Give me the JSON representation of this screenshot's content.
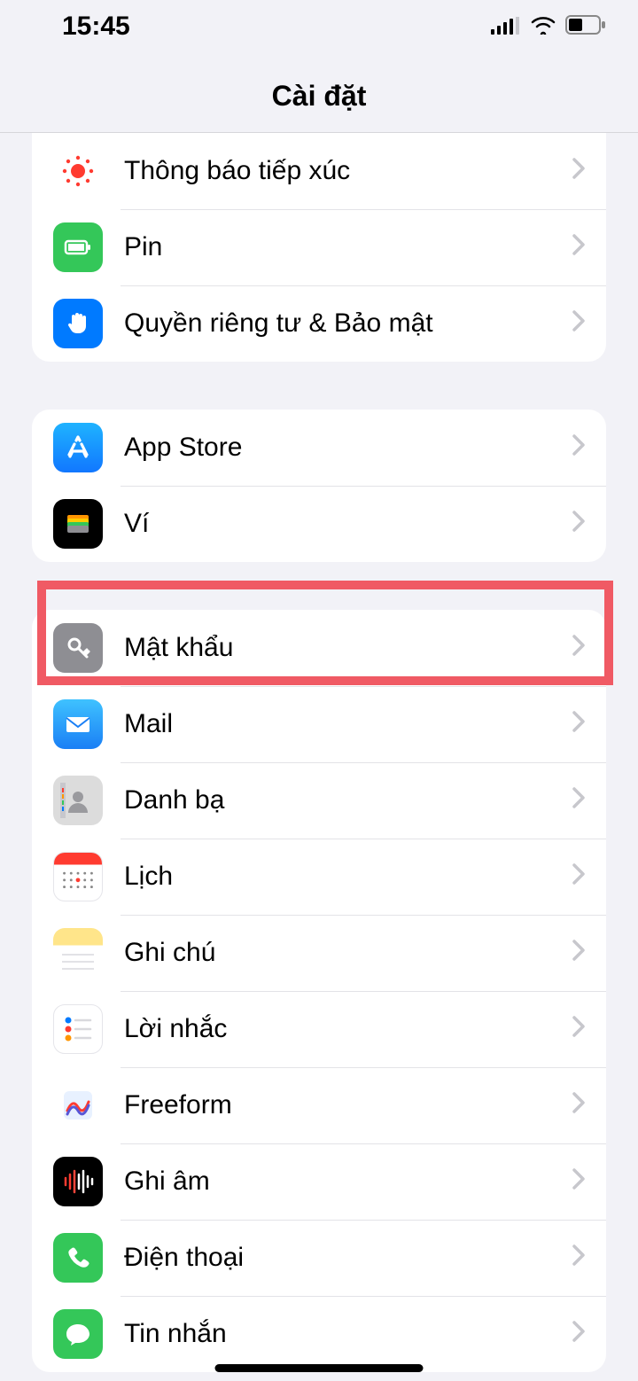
{
  "status": {
    "time": "15:45"
  },
  "header": {
    "title": "Cài đặt"
  },
  "groups": [
    {
      "rows": [
        {
          "id": "exposure",
          "label": "Thông báo tiếp xúc"
        },
        {
          "id": "battery",
          "label": "Pin"
        },
        {
          "id": "privacy",
          "label": "Quyền riêng tư & Bảo mật"
        }
      ]
    },
    {
      "rows": [
        {
          "id": "appstore",
          "label": "App Store"
        },
        {
          "id": "wallet",
          "label": "Ví"
        }
      ]
    },
    {
      "rows": [
        {
          "id": "passwords",
          "label": "Mật khẩu",
          "highlighted": true
        },
        {
          "id": "mail",
          "label": "Mail"
        },
        {
          "id": "contacts",
          "label": "Danh bạ"
        },
        {
          "id": "calendar",
          "label": "Lịch"
        },
        {
          "id": "notes",
          "label": "Ghi chú"
        },
        {
          "id": "reminders",
          "label": "Lời nhắc"
        },
        {
          "id": "freeform",
          "label": "Freeform"
        },
        {
          "id": "voicememo",
          "label": "Ghi âm"
        },
        {
          "id": "phone",
          "label": "Điện thoại"
        },
        {
          "id": "messages",
          "label": "Tin nhắn"
        }
      ]
    }
  ]
}
